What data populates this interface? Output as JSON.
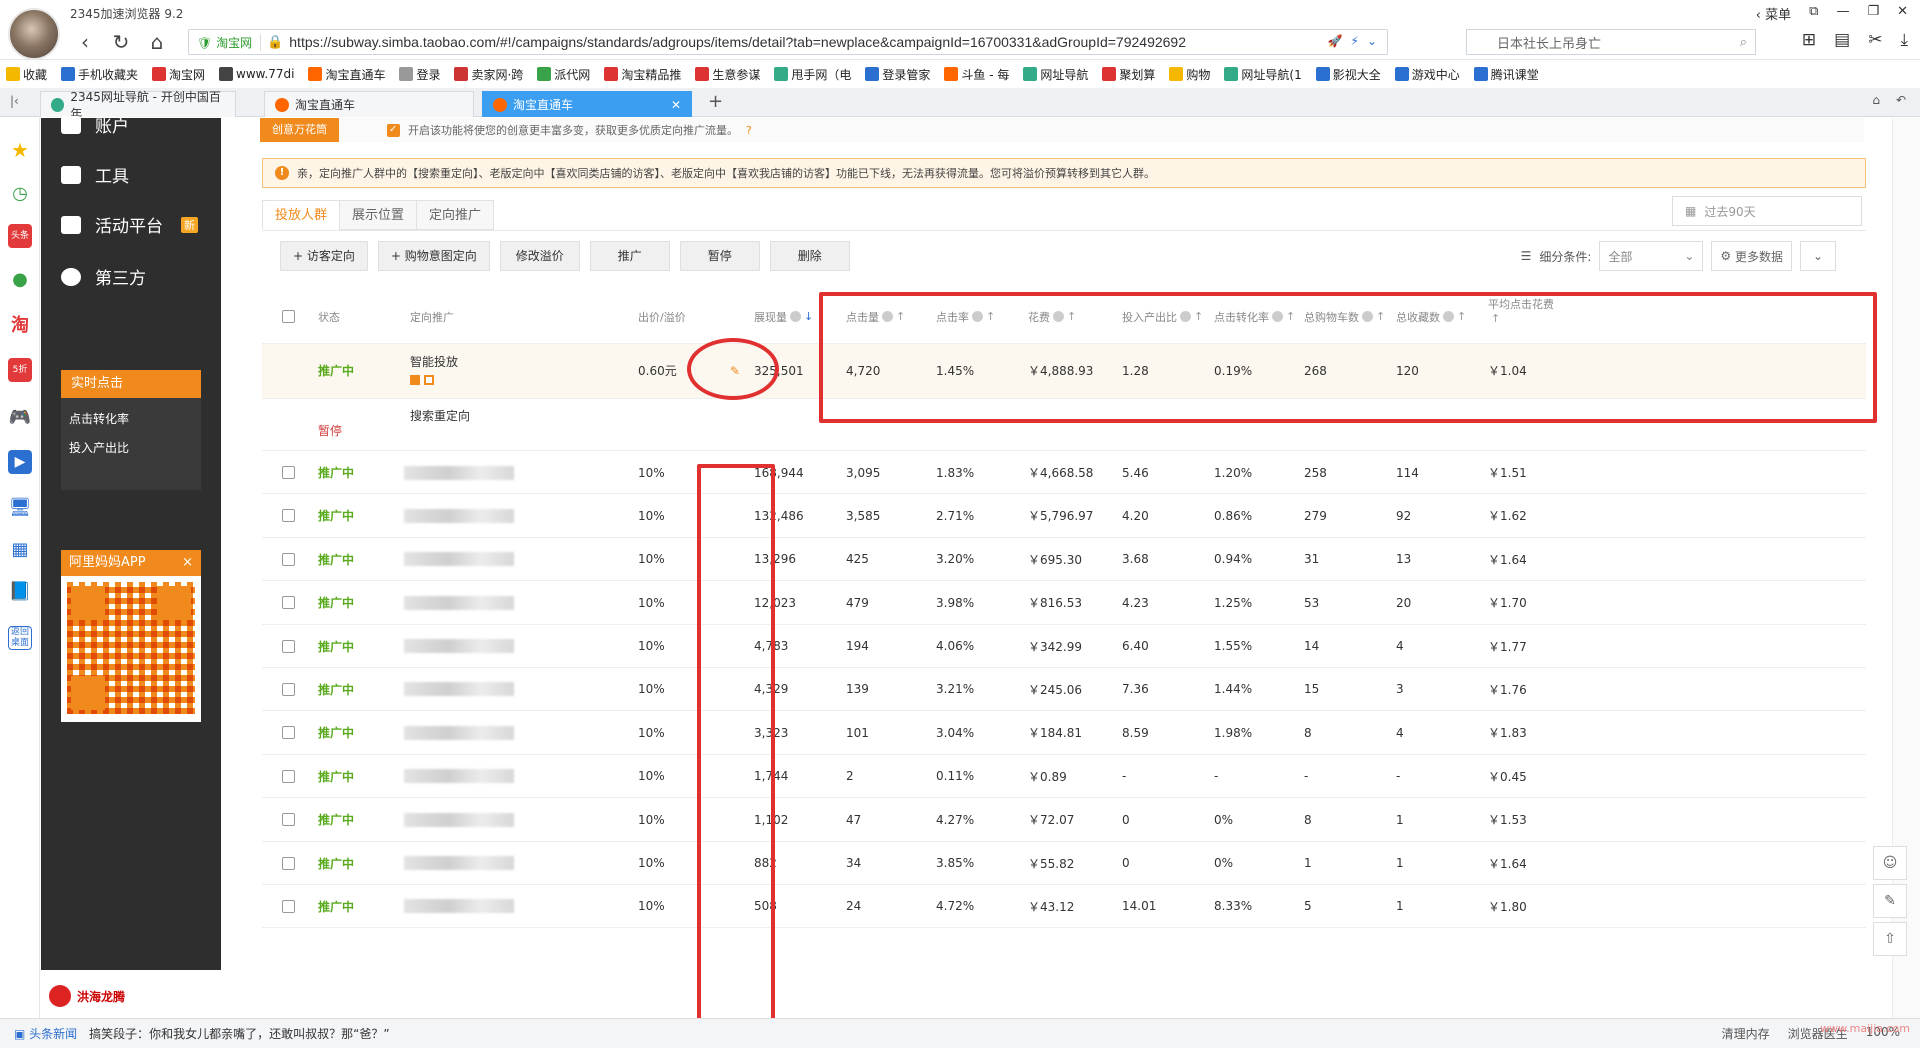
{
  "browser": {
    "app_title": "2345加速浏览器 9.2",
    "menu_label": "菜单",
    "url_badge": "淘宝网",
    "url": "https://subway.simba.taobao.com/#!/campaigns/standards/adgroups/items/detail?tab=newplace&campaignId=16700331&adGroupId=792492692",
    "search_text": "日本社长上吊身亡"
  },
  "bookmarks": [
    "收藏",
    "手机收藏夹",
    "淘宝网",
    "www.77di",
    "淘宝直通车",
    "登录",
    "卖家网·跨",
    "派代网",
    "淘宝精品推",
    "生意参谋",
    "甩手网（电",
    "登录管家",
    "斗鱼 - 每",
    "网址导航",
    "聚划算",
    "购物",
    "网址导航(1",
    "影视大全",
    "游戏中心",
    "腾讯课堂"
  ],
  "tabs": [
    {
      "label": "2345网址导航 - 开创中国百年"
    },
    {
      "label": "淘宝直通车"
    },
    {
      "label": "淘宝直通车"
    }
  ],
  "sidenav": {
    "account": "账户",
    "tools": "工具",
    "activity": "活动平台",
    "activity_badge": "新",
    "third": "第三方",
    "realtime_title": "实时点击",
    "realtime_items": [
      "点击转化率",
      "投入产出比"
    ],
    "qr_title": "阿里妈妈APP",
    "qr_close": "×",
    "brand": "洪海龙腾"
  },
  "top_strip": {
    "button": "创意万花筒",
    "checkbox_text": "开启该功能将使您的创意更丰富多变，获取更多优质定向推广流量。"
  },
  "notice": "亲，定向推广人群中的【搜索重定向】、老版定向中【喜欢同类店铺的访客】、老版定向中【喜欢我店铺的访客】功能已下线，无法再获得流量。您可将溢价预算转移到其它人群。",
  "subtabs": [
    "投放人群",
    "展示位置",
    "定向推广"
  ],
  "date_range": "过去90天",
  "actions": [
    "+ 访客定向",
    "+ 购物意图定向",
    "修改溢价",
    "推广",
    "暂停",
    "删除"
  ],
  "filter": {
    "label": "细分条件:",
    "value": "全部",
    "more": "更多数据"
  },
  "table": {
    "headers": {
      "status": "状态",
      "target": "定向推广",
      "bid": "出价/溢价",
      "impressions": "展现量",
      "clicks": "点击量",
      "ctr": "点击率",
      "cost": "花费",
      "roi": "投入产出比",
      "cvr": "点击转化率",
      "cart": "总购物车数",
      "fav": "总收藏数",
      "cpc": "平均点击花费"
    },
    "smart_row": {
      "status": "推广中",
      "name": "智能投放",
      "bid": "0.60元",
      "impressions": "325,501",
      "clicks": "4,720",
      "ctr": "1.45%",
      "cost": "￥4,888.93",
      "roi": "1.28",
      "cvr": "0.19%",
      "cart": "268",
      "fav": "120",
      "cpc": "￥1.04"
    },
    "search_row": {
      "status": "暂停",
      "name": "搜索重定向"
    },
    "rows": [
      {
        "status": "推广中",
        "bid": "10%",
        "impressions": "168,944",
        "clicks": "3,095",
        "ctr": "1.83%",
        "cost": "￥4,668.58",
        "roi": "5.46",
        "cvr": "1.20%",
        "cart": "258",
        "fav": "114",
        "cpc": "￥1.51"
      },
      {
        "status": "推广中",
        "bid": "10%",
        "impressions": "132,486",
        "clicks": "3,585",
        "ctr": "2.71%",
        "cost": "￥5,796.97",
        "roi": "4.20",
        "cvr": "0.86%",
        "cart": "279",
        "fav": "92",
        "cpc": "￥1.62"
      },
      {
        "status": "推广中",
        "bid": "10%",
        "impressions": "13,296",
        "clicks": "425",
        "ctr": "3.20%",
        "cost": "￥695.30",
        "roi": "3.68",
        "cvr": "0.94%",
        "cart": "31",
        "fav": "13",
        "cpc": "￥1.64"
      },
      {
        "status": "推广中",
        "bid": "10%",
        "impressions": "12,023",
        "clicks": "479",
        "ctr": "3.98%",
        "cost": "￥816.53",
        "roi": "4.23",
        "cvr": "1.25%",
        "cart": "53",
        "fav": "20",
        "cpc": "￥1.70"
      },
      {
        "status": "推广中",
        "bid": "10%",
        "impressions": "4,783",
        "clicks": "194",
        "ctr": "4.06%",
        "cost": "￥342.99",
        "roi": "6.40",
        "cvr": "1.55%",
        "cart": "14",
        "fav": "4",
        "cpc": "￥1.77"
      },
      {
        "status": "推广中",
        "bid": "10%",
        "impressions": "4,329",
        "clicks": "139",
        "ctr": "3.21%",
        "cost": "￥245.06",
        "roi": "7.36",
        "cvr": "1.44%",
        "cart": "15",
        "fav": "3",
        "cpc": "￥1.76"
      },
      {
        "status": "推广中",
        "bid": "10%",
        "impressions": "3,323",
        "clicks": "101",
        "ctr": "3.04%",
        "cost": "￥184.81",
        "roi": "8.59",
        "cvr": "1.98%",
        "cart": "8",
        "fav": "4",
        "cpc": "￥1.83"
      },
      {
        "status": "推广中",
        "bid": "10%",
        "impressions": "1,744",
        "clicks": "2",
        "ctr": "0.11%",
        "cost": "￥0.89",
        "roi": "-",
        "cvr": "-",
        "cart": "-",
        "fav": "-",
        "cpc": "￥0.45"
      },
      {
        "status": "推广中",
        "bid": "10%",
        "impressions": "1,102",
        "clicks": "47",
        "ctr": "4.27%",
        "cost": "￥72.07",
        "roi": "0",
        "cvr": "0%",
        "cart": "8",
        "fav": "1",
        "cpc": "￥1.53"
      },
      {
        "status": "推广中",
        "bid": "10%",
        "impressions": "882",
        "clicks": "34",
        "ctr": "3.85%",
        "cost": "￥55.82",
        "roi": "0",
        "cvr": "0%",
        "cart": "1",
        "fav": "1",
        "cpc": "￥1.64"
      },
      {
        "status": "推广中",
        "bid": "10%",
        "impressions": "508",
        "clicks": "24",
        "ctr": "4.72%",
        "cost": "￥43.12",
        "roi": "14.01",
        "cvr": "8.33%",
        "cart": "5",
        "fav": "1",
        "cpc": "￥1.80"
      }
    ]
  },
  "statusbar": {
    "news_label": "头条新闻",
    "news_text": "搞笑段子：你和我女儿都亲嘴了，还敢叫叔叔？那“爸？”",
    "right": [
      "清理内存",
      "浏览器医生",
      "100%"
    ]
  },
  "watermark": "www.maijia.com",
  "colors": {
    "accent": "#f08a1c",
    "annotation": "#e03030",
    "status_on": "#5aaa1e",
    "tab_active": "#3b9ef0"
  }
}
